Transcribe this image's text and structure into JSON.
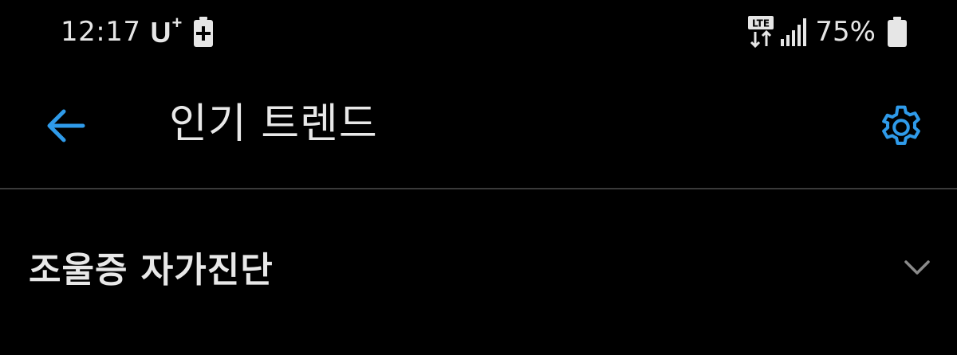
{
  "status_bar": {
    "time": "12:17",
    "carrier": "U",
    "carrier_super": "+",
    "network_type": "LTE",
    "battery_percent": "75%"
  },
  "app_bar": {
    "title": "인기 트렌드",
    "accent_color": "#2f9bea"
  },
  "list": {
    "items": [
      {
        "label": "조울증 자가진단",
        "expanded": false
      }
    ]
  },
  "icons": {
    "back": "arrow-left-icon",
    "settings": "gear-icon",
    "expand": "chevron-down-icon",
    "charging": "battery-charging-icon",
    "lte": "lte-data-icon",
    "signal": "cell-signal-icon",
    "battery": "battery-icon"
  }
}
